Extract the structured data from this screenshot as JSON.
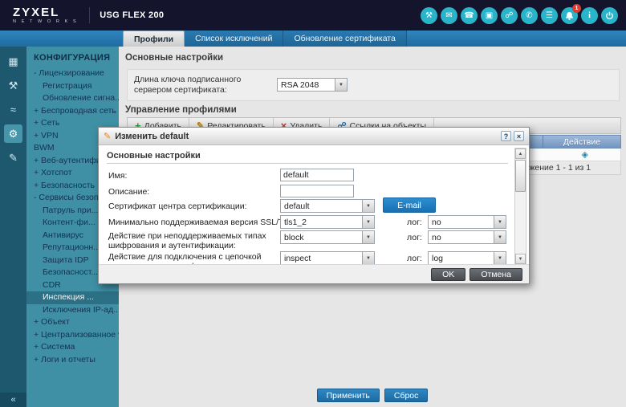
{
  "header": {
    "brand": "ZYXEL",
    "brand_sub": "N E T W O R K S",
    "product": "USG FLEX 200",
    "notification_count": "1",
    "icons": [
      {
        "name": "wrench",
        "glyph": "⚒"
      },
      {
        "name": "mail",
        "glyph": "✉"
      },
      {
        "name": "phone",
        "glyph": "☎"
      },
      {
        "name": "monitor",
        "glyph": "▣"
      },
      {
        "name": "network",
        "glyph": "☍"
      },
      {
        "name": "support",
        "glyph": "✆"
      },
      {
        "name": "forum",
        "glyph": "☰"
      }
    ]
  },
  "colors": {
    "accent_teal": "#2ab4c9",
    "brand_navy": "#14142c",
    "tab_blue": "#2677ad",
    "badge_red": "#e23a2e",
    "button_blue": "#1d76b4",
    "sidebar_teal": "#3f90a5"
  },
  "tabs": {
    "profiles": "Профили",
    "exceptions": "Список исключений",
    "cert_update": "Обновление сертификата"
  },
  "sidebar": {
    "title": "КОНФИГУРАЦИЯ",
    "rail": [
      {
        "glyph": "▦"
      },
      {
        "glyph": "⚒"
      },
      {
        "glyph": "≈"
      },
      {
        "glyph": "⚙",
        "selected": true
      },
      {
        "glyph": "✎"
      }
    ],
    "items": [
      {
        "label": "- Лицензирование"
      },
      {
        "label": "Регистрация"
      },
      {
        "label": "Обновление сигна..."
      },
      {
        "label": "+ Беспроводная сеть"
      },
      {
        "label": "+ Сеть"
      },
      {
        "label": "+ VPN"
      },
      {
        "label": "BWM"
      },
      {
        "label": "+ Веб-аутентифика..."
      },
      {
        "label": "+ Хотспот"
      },
      {
        "label": "+ Безопасность"
      },
      {
        "label": "- Сервисы безопа..."
      },
      {
        "label": "Патруль при..."
      },
      {
        "label": "Контент-фи..."
      },
      {
        "label": "Антивирус"
      },
      {
        "label": "Репутационн..."
      },
      {
        "label": "Защита IDP"
      },
      {
        "label": "Безопасност..."
      },
      {
        "label": "CDR"
      },
      {
        "label": "Инспекция ...",
        "selected": true
      },
      {
        "label": "Исключения IP-ад..."
      },
      {
        "label": "+ Объект"
      },
      {
        "label": "+ Централизованное у..."
      },
      {
        "label": "+ Система"
      },
      {
        "label": "+ Логи и отчеты"
      }
    ]
  },
  "main": {
    "section_general": "Основные настройки",
    "key_length_label": "Длина ключа подписанного сервером сертификата:",
    "key_length_value": "RSA 2048",
    "section_profiles": "Управление профилями",
    "toolbar": {
      "add": "Добавить",
      "edit": "Редактировать",
      "delete": "Удалить",
      "refs": "Ссылки на объекты"
    },
    "table": {
      "action_header": "Действие"
    },
    "paging": "Отображение 1 - 1 из 1"
  },
  "dialog": {
    "title": "Изменить default",
    "section": "Основные настройки",
    "name_label": "Имя:",
    "name_value": "default",
    "desc_label": "Описание:",
    "desc_value": "",
    "ca_label": "Сертификат центра сертификации:",
    "ca_value": "default",
    "email_button": "E-mail",
    "ssl_label": "Минимально поддерживаемая версия SSL/TLS:",
    "ssl_value": "tls1_2",
    "log_label": "лог:",
    "ssl_log": "no",
    "cipher_label": "Действие при неподдерживаемых типах шифрования и аутентификации:",
    "cipher_value": "block",
    "cipher_log": "no",
    "chain_label": "Действие для подключения с цепочкой недоверенных сертификатов:",
    "chain_value": "inspect",
    "chain_log": "log",
    "ok": "OK",
    "cancel": "Отмена"
  },
  "footer": {
    "apply": "Применить",
    "reset": "Сброс"
  },
  "icons": {
    "dropdown": "▼",
    "up": "▲",
    "down": "▼",
    "add": "+",
    "edit": "✎",
    "delete": "×",
    "refs": "☍",
    "help": "?",
    "close": "×",
    "collapse": "«",
    "row_action": "◈",
    "info": "i"
  }
}
